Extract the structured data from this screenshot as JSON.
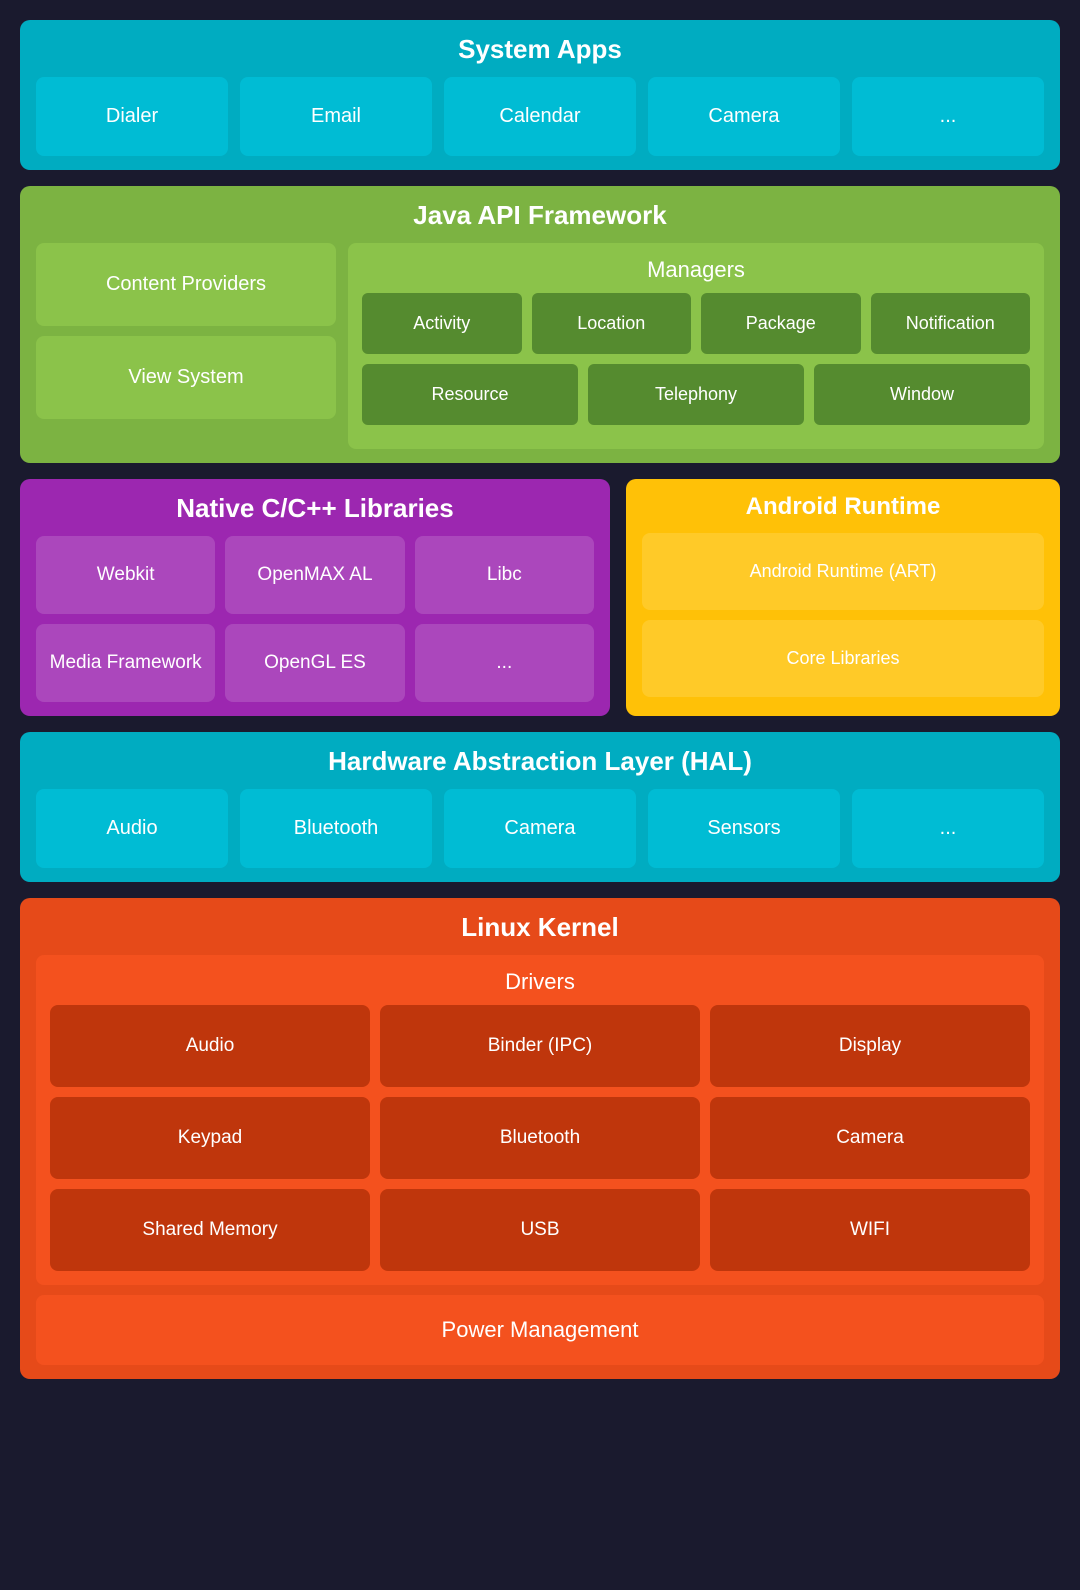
{
  "system_apps": {
    "title": "System Apps",
    "apps": [
      "Dialer",
      "Email",
      "Calendar",
      "Camera",
      "..."
    ]
  },
  "java_api": {
    "title": "Java API Framework",
    "left": [
      "Content Providers",
      "View System"
    ],
    "managers": {
      "title": "Managers",
      "row1": [
        "Activity",
        "Location",
        "Package",
        "Notification"
      ],
      "row2": [
        "Resource",
        "Telephony",
        "Window"
      ]
    }
  },
  "native_libs": {
    "title": "Native C/C++ Libraries",
    "items": [
      "Webkit",
      "OpenMAX AL",
      "Libc",
      "Media Framework",
      "OpenGL ES",
      "..."
    ]
  },
  "android_runtime": {
    "title": "Android Runtime",
    "items": [
      "Android Runtime (ART)",
      "Core Libraries"
    ]
  },
  "hal": {
    "title": "Hardware Abstraction Layer (HAL)",
    "items": [
      "Audio",
      "Bluetooth",
      "Camera",
      "Sensors",
      "..."
    ]
  },
  "linux_kernel": {
    "title": "Linux Kernel",
    "drivers_title": "Drivers",
    "drivers": [
      "Audio",
      "Binder (IPC)",
      "Display",
      "Keypad",
      "Bluetooth",
      "Camera",
      "Shared Memory",
      "USB",
      "WIFI"
    ],
    "power_management": "Power Management"
  }
}
